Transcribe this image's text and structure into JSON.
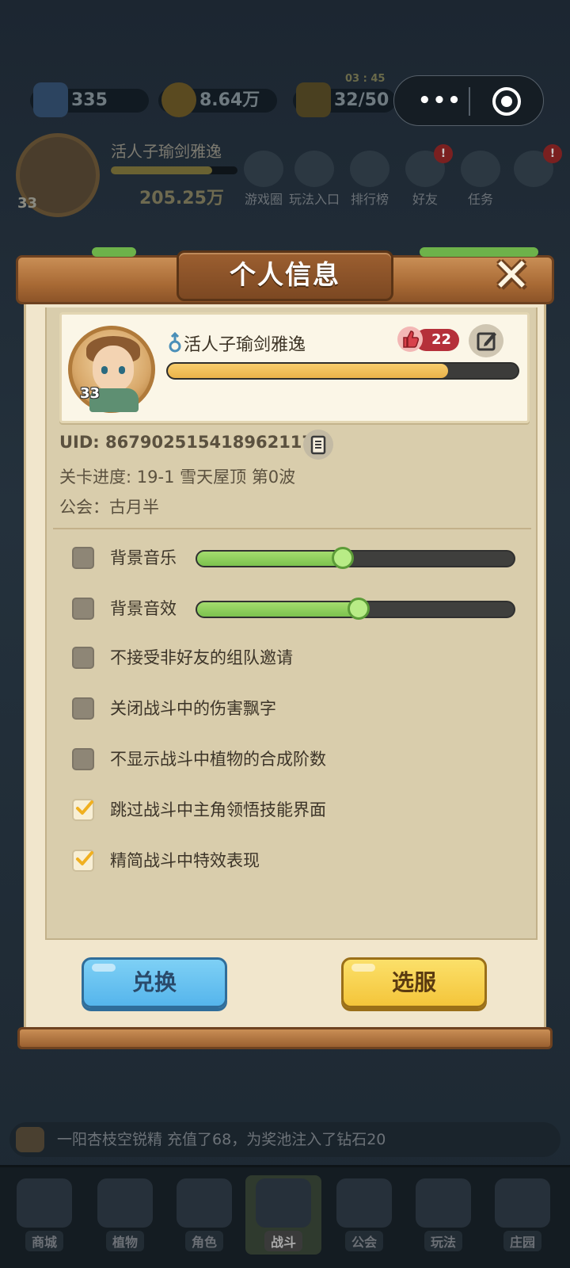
{
  "hud": {
    "diamonds": "335",
    "gold": "8.64万",
    "energy": "32/50",
    "energy_timer": "03 : 45",
    "player_name": "活人子瑜剑雅逸",
    "player_gold": "205.25万",
    "level": "33",
    "menu": [
      {
        "label": "游戏圈",
        "icon": "game-circle-icon"
      },
      {
        "label": "玩法入口",
        "icon": "gamepad-icon"
      },
      {
        "label": "排行榜",
        "icon": "ranking-icon"
      },
      {
        "label": "好友",
        "icon": "friends-icon"
      },
      {
        "label": "任务",
        "icon": "tasks-icon"
      }
    ]
  },
  "ticker": {
    "text": "一阳杏枝空锐精 充值了68，为奖池注入了钻石20"
  },
  "bottom_nav": [
    {
      "label": "商城",
      "icon": "shop-icon"
    },
    {
      "label": "植物",
      "icon": "plant-icon"
    },
    {
      "label": "角色",
      "icon": "character-icon"
    },
    {
      "label": "战斗",
      "icon": "battle-icon",
      "active": true
    },
    {
      "label": "公会",
      "icon": "guild-icon"
    },
    {
      "label": "玩法",
      "icon": "gameplay-icon"
    },
    {
      "label": "庄园",
      "icon": "manor-icon"
    }
  ],
  "modal": {
    "title": "个人信息",
    "profile": {
      "level": "33",
      "name": "活人子瑜剑雅逸",
      "likes": "22",
      "exp_progress": 0.8
    },
    "uid_label": "UID: ",
    "uid": "867902515418962117",
    "stage_label": "关卡进度: ",
    "stage_value": "19-1  雪天屋顶 第0波",
    "guild_label": "公会：",
    "guild_value": "古月半",
    "settings": [
      {
        "label": "背景音乐",
        "checked": false,
        "slider": 0.46
      },
      {
        "label": "背景音效",
        "checked": false,
        "slider": 0.51
      },
      {
        "label": "不接受非好友的组队邀请",
        "checked": false
      },
      {
        "label": "关闭战斗中的伤害飘字",
        "checked": false
      },
      {
        "label": "不显示战斗中植物的合成阶数",
        "checked": false
      },
      {
        "label": "跳过战斗中主角领悟技能界面",
        "checked": true
      },
      {
        "label": "精简战斗中特效表现",
        "checked": true
      }
    ],
    "exchange_label": "兑换",
    "select_server_label": "选服"
  }
}
